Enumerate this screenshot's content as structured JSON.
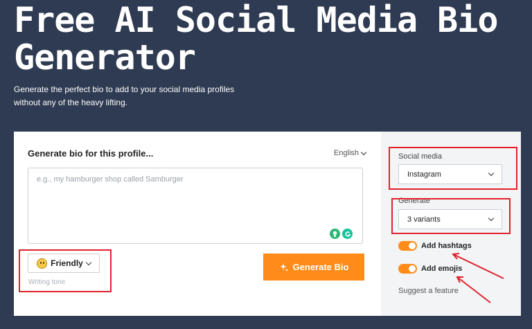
{
  "hero": {
    "title": "Free AI Social Media Bio Generator",
    "subtitle": "Generate the perfect bio to add to your social media profiles without any of the heavy lifting."
  },
  "form": {
    "heading": "Generate bio for this profile...",
    "language": "English",
    "input_placeholder": "e.g., my hamburger shop called Samburger",
    "tone_value": "Friendly",
    "tone_caption": "Writing tone",
    "generate_label": "Generate Bio"
  },
  "options": {
    "social_label": "Social media",
    "social_value": "Instagram",
    "generate_label": "Generate",
    "generate_value": "3 variants",
    "hashtags_label": "Add hashtags",
    "hashtags_on": true,
    "emojis_label": "Add emojis",
    "emojis_on": true,
    "suggest_label": "Suggest a feature"
  },
  "colors": {
    "background": "#2f3b52",
    "accent": "#ff8c1a",
    "annotation": "#e0212b"
  }
}
